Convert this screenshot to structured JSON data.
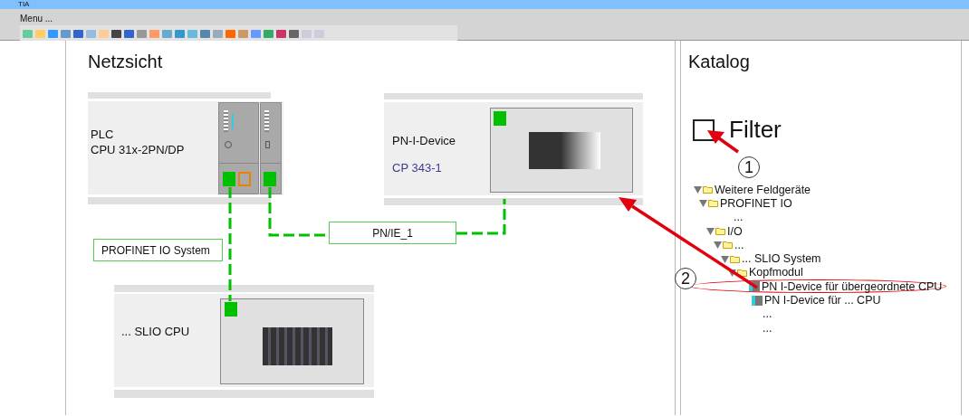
{
  "window": {
    "title": "TIA"
  },
  "menu": {
    "label": "Menu ..."
  },
  "network_view": {
    "title": "Netzsicht",
    "devices": [
      {
        "kind": "plc",
        "name": "PLC",
        "type": "CPU 31x-2PN/DP"
      },
      {
        "kind": "cp",
        "name": "PN-I-Device",
        "type": "CP 343-1"
      },
      {
        "kind": "slio",
        "name": "... SLIO CPU"
      }
    ],
    "networks": [
      {
        "label": "PN/IE_1"
      },
      {
        "label": "PROFINET IO System"
      }
    ]
  },
  "catalog": {
    "title": "Katalog",
    "filter": {
      "label": "Filter",
      "checked": false
    },
    "tree": [
      {
        "kind": "folder",
        "label": "Weitere Feldgeräte",
        "expanded": true,
        "children": [
          {
            "kind": "folder",
            "label": "PROFINET IO",
            "expanded": true,
            "children": [
              {
                "kind": "text",
                "label": "..."
              },
              {
                "kind": "folder",
                "label": "I/O",
                "expanded": true,
                "children": [
                  {
                    "kind": "folder",
                    "label": "...",
                    "expanded": true,
                    "children": [
                      {
                        "kind": "folder",
                        "label": "... SLIO System",
                        "expanded": true,
                        "children": [
                          {
                            "kind": "folder",
                            "label": "Kopfmodul",
                            "expanded": true,
                            "children": [
                              {
                                "kind": "device",
                                "label": "PN I-Device für übergeordnete CPU",
                                "highlighted": true
                              },
                              {
                                "kind": "device",
                                "label": "PN I-Device für ... CPU",
                                "highlighted": false
                              },
                              {
                                "kind": "text",
                                "label": "..."
                              },
                              {
                                "kind": "text",
                                "label": "..."
                              }
                            ]
                          }
                        ]
                      }
                    ]
                  }
                ]
              }
            ]
          }
        ]
      }
    ]
  },
  "callouts": [
    {
      "label": "1"
    },
    {
      "label": "2"
    }
  ]
}
